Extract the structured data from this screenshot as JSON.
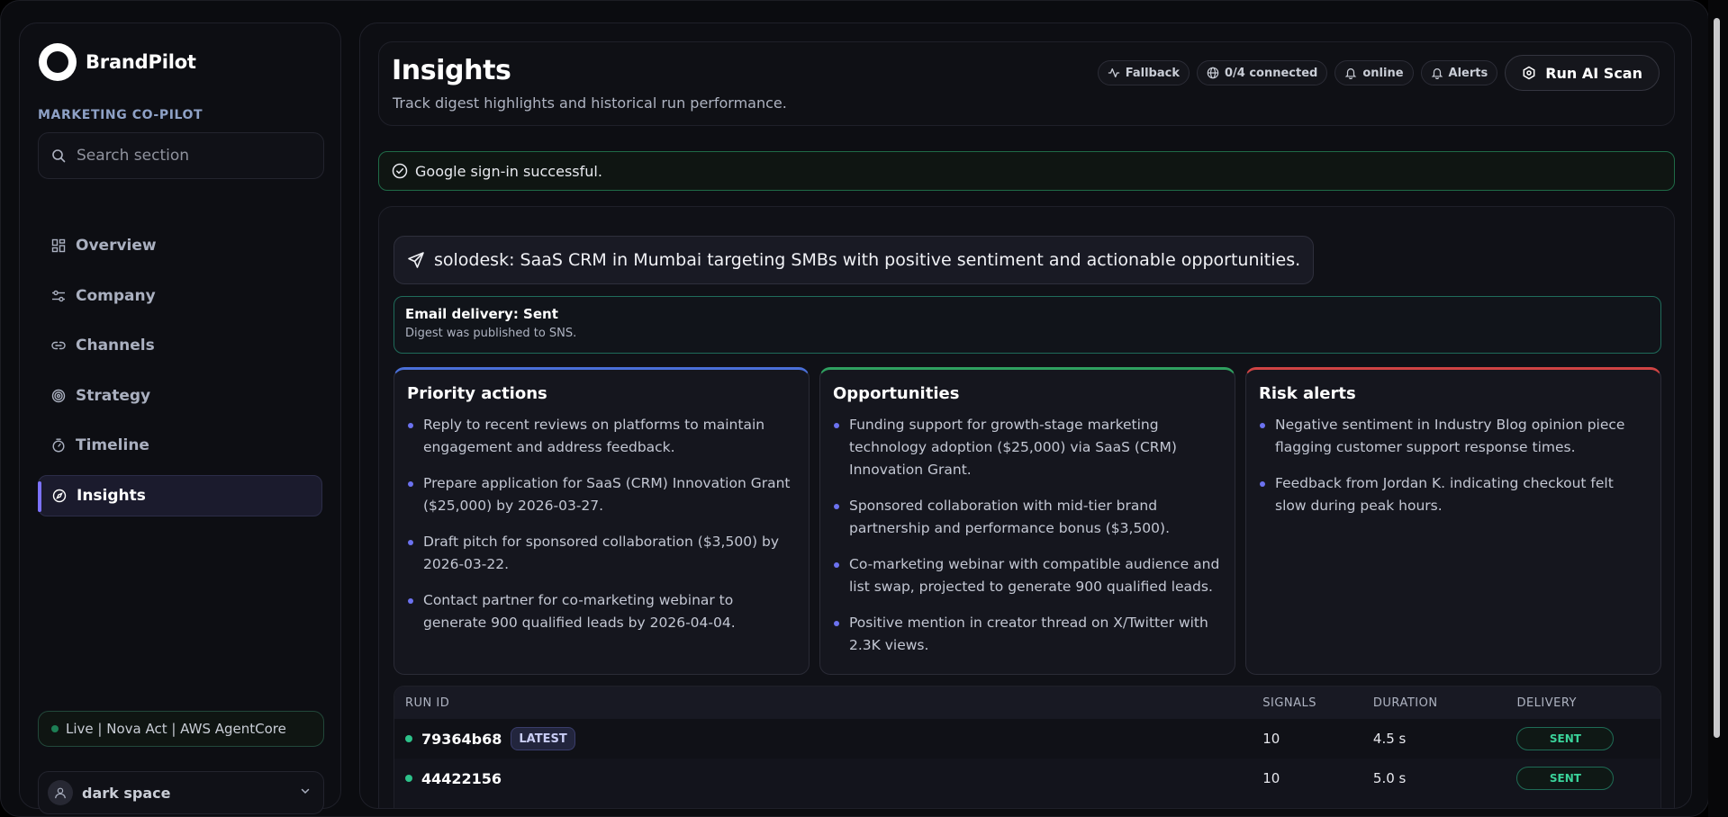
{
  "sidebar": {
    "brand_name": "BrandPilot",
    "brand_subtitle": "MARKETING CO-PILOT",
    "search_placeholder": "Search section",
    "items": [
      {
        "label": "Overview",
        "icon": "grid-icon"
      },
      {
        "label": "Company",
        "icon": "sliders-icon"
      },
      {
        "label": "Channels",
        "icon": "link-icon"
      },
      {
        "label": "Strategy",
        "icon": "target-icon"
      },
      {
        "label": "Timeline",
        "icon": "timer-icon"
      },
      {
        "label": "Insights",
        "icon": "compass-icon",
        "active": true
      }
    ],
    "status": "Live | Nova Act | AWS AgentCore",
    "user": "dark space"
  },
  "header": {
    "title": "Insights",
    "subtitle": "Track digest highlights and historical run performance.",
    "chips": [
      "Fallback",
      "0/4 connected",
      "online",
      "Alerts"
    ],
    "run_button": "Run AI Scan"
  },
  "banner": "Google sign-in successful.",
  "summary": "solodesk: SaaS CRM in Mumbai targeting SMBs with positive sentiment and actionable opportunities.",
  "email": {
    "title": "Email delivery: Sent",
    "detail": "Digest was published to SNS."
  },
  "cards": {
    "priority": {
      "title": "Priority actions",
      "items": [
        "Reply to recent reviews on platforms to maintain engagement and address feedback.",
        "Prepare application for SaaS (CRM) Innovation Grant ($25,000) by 2026-03-27.",
        "Draft pitch for sponsored collaboration ($3,500) by 2026-03-22.",
        "Contact partner for co-marketing webinar to generate 900 qualified leads by 2026-04-04."
      ]
    },
    "opportunities": {
      "title": "Opportunities",
      "items": [
        "Funding support for growth-stage marketing technology adoption ($25,000) via SaaS (CRM) Innovation Grant.",
        "Sponsored collaboration with mid-tier brand partnership and performance bonus ($3,500).",
        "Co-marketing webinar with compatible audience and list swap, projected to generate 900 qualified leads.",
        "Positive mention in creator thread on X/Twitter with 2.3K views."
      ]
    },
    "risks": {
      "title": "Risk alerts",
      "items": [
        "Negative sentiment in Industry Blog opinion piece flagging customer support response times.",
        "Feedback from Jordan K. indicating checkout felt slow during peak hours."
      ]
    }
  },
  "table": {
    "headers": [
      "RUN ID",
      "SIGNALS",
      "DURATION",
      "DELIVERY"
    ],
    "rows": [
      {
        "id": "79364b68",
        "badge": "LATEST",
        "signals": "10",
        "duration": "4.5 s",
        "delivery": "SENT"
      },
      {
        "id": "44422156",
        "signals": "10",
        "duration": "5.0 s",
        "delivery": "SENT"
      }
    ]
  },
  "colors": {
    "accent": "#7c72ff",
    "success": "#2dc28a",
    "priority_border": "#4a6fd8",
    "opportunity_border": "#2fa060",
    "risk_border": "#d04444"
  }
}
